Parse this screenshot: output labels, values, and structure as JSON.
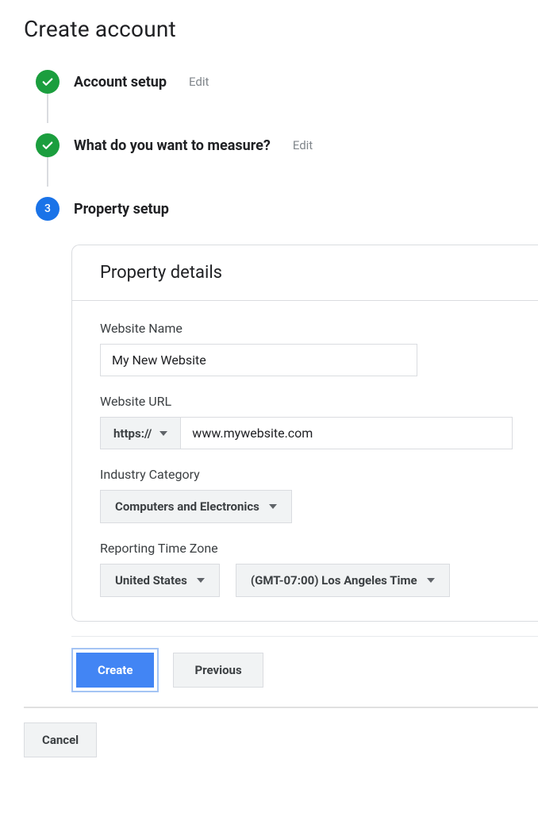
{
  "page_title": "Create account",
  "steps": {
    "s1": {
      "label": "Account setup",
      "edit": "Edit"
    },
    "s2": {
      "label": "What do you want to measure?",
      "edit": "Edit"
    },
    "s3": {
      "number": "3",
      "label": "Property setup"
    }
  },
  "card": {
    "title": "Property details",
    "website_name": {
      "label": "Website Name",
      "value": "My New Website"
    },
    "website_url": {
      "label": "Website URL",
      "protocol": "https://",
      "value": "www.mywebsite.com"
    },
    "industry": {
      "label": "Industry Category",
      "value": "Computers and Electronics"
    },
    "timezone": {
      "label": "Reporting Time Zone",
      "country": "United States",
      "zone": "(GMT-07:00) Los Angeles Time"
    }
  },
  "buttons": {
    "create": "Create",
    "previous": "Previous",
    "cancel": "Cancel"
  }
}
